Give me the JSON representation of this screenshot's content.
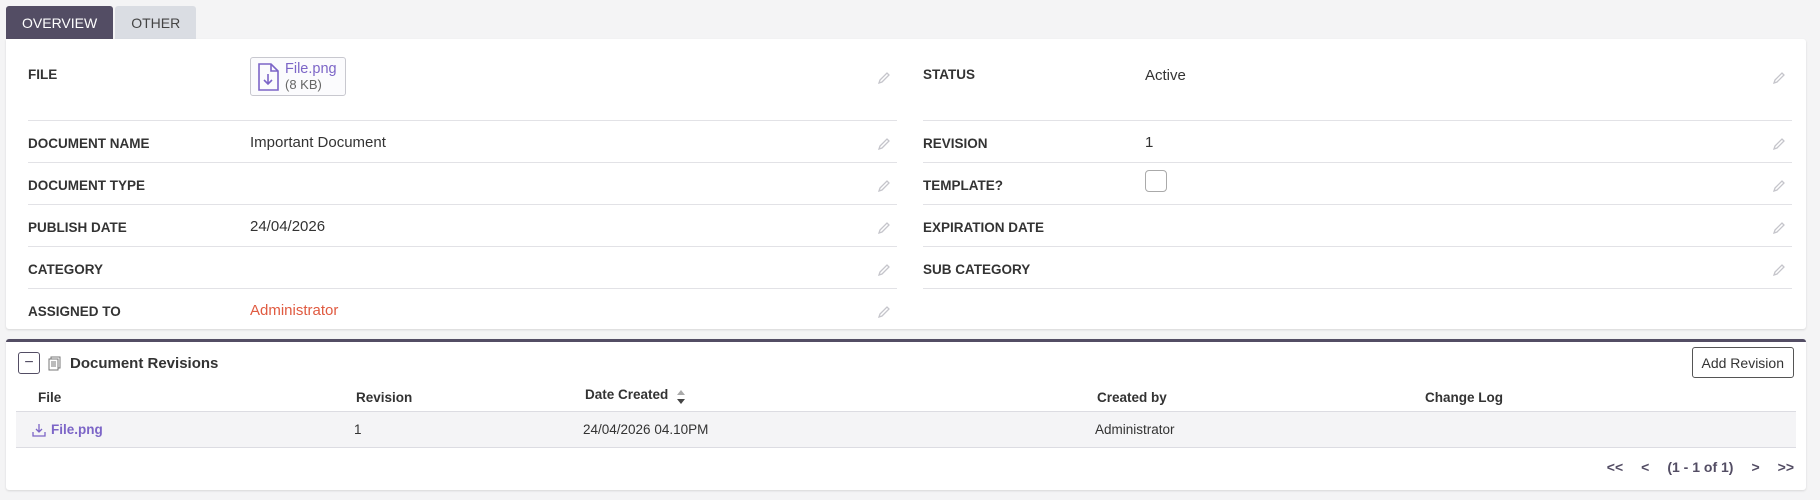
{
  "tabs": [
    {
      "label": "OVERVIEW",
      "active": true
    },
    {
      "label": "OTHER",
      "active": false
    }
  ],
  "left_fields": {
    "file": {
      "label": "FILE",
      "file_name": "File.png",
      "file_size": "(8 KB)"
    },
    "document_name": {
      "label": "DOCUMENT NAME",
      "value": "Important Document"
    },
    "document_type": {
      "label": "DOCUMENT TYPE",
      "value": ""
    },
    "publish_date": {
      "label": "PUBLISH DATE",
      "value": "24/04/2026"
    },
    "category": {
      "label": "CATEGORY",
      "value": ""
    },
    "assigned_to": {
      "label": "ASSIGNED TO",
      "value": "Administrator"
    }
  },
  "right_fields": {
    "status": {
      "label": "STATUS",
      "value": "Active"
    },
    "revision": {
      "label": "REVISION",
      "value": "1"
    },
    "template": {
      "label": "TEMPLATE?",
      "checked": false
    },
    "expiration_date": {
      "label": "EXPIRATION DATE",
      "value": ""
    },
    "sub_category": {
      "label": "SUB CATEGORY",
      "value": ""
    }
  },
  "revisions_panel": {
    "collapse_symbol": "−",
    "title": "Document Revisions",
    "add_button": "Add Revision",
    "columns": {
      "file": "File",
      "revision": "Revision",
      "date_created": "Date Created",
      "created_by": "Created by",
      "change_log": "Change Log"
    },
    "rows": [
      {
        "file": "File.png",
        "revision": "1",
        "date_created": "24/04/2026 04.10PM",
        "created_by": "Administrator",
        "change_log": ""
      }
    ],
    "pager": {
      "first": "<<",
      "prev": "<",
      "info": "(1 - 1 of 1)",
      "next": ">",
      "last": ">>"
    }
  },
  "colors": {
    "accent": "#534d64",
    "link_purple": "#7c65c7",
    "link_red": "#e05a40"
  }
}
